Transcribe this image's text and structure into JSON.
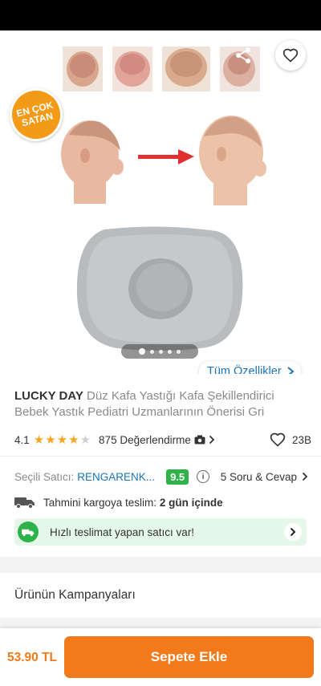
{
  "badge": {
    "line1": "EN ÇOK",
    "line2": "SATAN"
  },
  "carousel": {
    "total": 5,
    "active": 1
  },
  "all_features_label": "Tüm Özellikler",
  "product": {
    "brand": "LUCKY DAY",
    "name": "Düz Kafa Yastığı Kafa Şekillendirici Bebek Yastık Pediatri Uzmanlarının Önerisi Gri"
  },
  "rating": {
    "score": "4.1",
    "stars_filled": 4,
    "stars_total": 5,
    "reviews_label": "875 Değerlendirme",
    "favorites": "23B"
  },
  "seller": {
    "label": "Seçili Satıcı:",
    "name": "RENGARENK...",
    "score": "9.5",
    "qa_label": "5 Soru & Cevap"
  },
  "shipping": {
    "label": "Tahmini kargoya teslim:",
    "value": "2 gün içinde"
  },
  "fast_delivery_label": "Hızlı teslimat yapan satıcı var!",
  "campaign_label": "Ürünün Kampanyaları",
  "bottom": {
    "price": "53.90 TL",
    "add_to_cart": "Sepete Ekle"
  },
  "colors": {
    "brand_orange": "#f27a1a",
    "badge_orange": "#f39a16",
    "link_blue": "#1a73b8",
    "success_green": "#2eb34a",
    "star_yellow": "#f5a623"
  },
  "icons": [
    "back-arrow-icon",
    "share-icon",
    "heart-icon",
    "chevron-right-icon",
    "camera-icon",
    "info-icon",
    "truck-icon"
  ]
}
